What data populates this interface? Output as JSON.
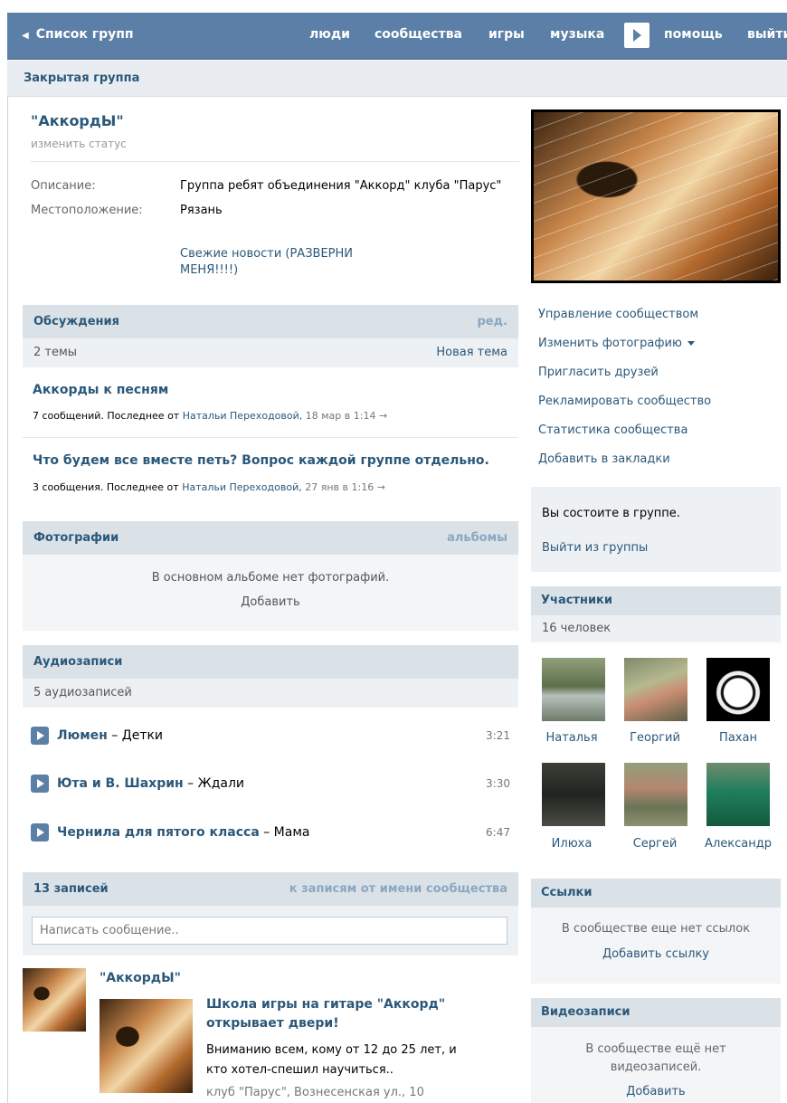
{
  "topbar": {
    "back_label": "Список групп",
    "nav": [
      "люди",
      "сообщества",
      "игры",
      "музыка",
      "помощь",
      "выйти"
    ]
  },
  "subheader": {
    "title": "Закрытая группа"
  },
  "group": {
    "name": "\"АккордЫ\"",
    "status_link": "изменить статус",
    "description_label": "Описание:",
    "description_value": "Группа ребят объединения \"Аккорд\" клуба \"Парус\"",
    "location_label": "Местоположение:",
    "location_value": "Рязань",
    "news_link": "Свежие новости (РАЗВЕРНИ МЕНЯ!!!!)"
  },
  "discussions": {
    "title": "Обсуждения",
    "edit": "ред.",
    "count": "2 темы",
    "new_topic": "Новая тема",
    "topics": [
      {
        "title": "Аккорды к песням",
        "meta_prefix": "7 сообщений. Последнее от",
        "author": "Натальи Переходовой,",
        "date": "18 мар в 1:14",
        "arrow": "→"
      },
      {
        "title": "Что будем все вместе петь? Вопрос каждой группе отдельно.",
        "meta_prefix": "3 сообщения. Последнее от",
        "author": "Натальи Переходовой,",
        "date": "27 янв в 1:16",
        "arrow": "→"
      }
    ]
  },
  "photos": {
    "title": "Фотографии",
    "albums": "альбомы",
    "empty": "В основном альбоме нет фотографий.",
    "add": "Добавить"
  },
  "audio": {
    "title": "Аудиозаписи",
    "count": "5 аудиозаписей",
    "tracks": [
      {
        "artist": "Люмен",
        "sep": " – ",
        "song": "Детки",
        "time": "3:21"
      },
      {
        "artist": "Юта и В. Шахрин",
        "sep": " – ",
        "song": "Ждали",
        "time": "3:30"
      },
      {
        "artist": "Чернила для пятого класса",
        "sep": " – ",
        "song": "Мама",
        "time": "6:47"
      }
    ]
  },
  "wall": {
    "title": "13 записей",
    "as_community": "к записям от имени сообщества",
    "placeholder": "Написать сообщение..",
    "post": {
      "author": "\"АккордЫ\"",
      "title": "Школа игры на гитаре \"Аккорд\" открывает двери!",
      "text": "Вниманию всем, кому от 12 до 25 лет, и кто хотел-спешил научиться..",
      "address": "клуб \"Парус\", Вознесенская ул., 10"
    }
  },
  "actions": [
    "Управление сообществом",
    "Изменить фотографию",
    "Пригласить друзей",
    "Рекламировать сообщество",
    "Статистика сообщества",
    "Добавить в закладки"
  ],
  "membership": {
    "status": "Вы состоите в группе.",
    "leave": "Выйти из группы"
  },
  "members": {
    "title": "Участники",
    "count": "16 человек",
    "list": [
      "Наталья",
      "Георгий",
      "Пахан",
      "Илюха",
      "Сергей",
      "Александр"
    ]
  },
  "links": {
    "title": "Ссылки",
    "empty": "В сообществе еще нет ссылок",
    "add": "Добавить ссылку"
  },
  "videos": {
    "title": "Видеозаписи",
    "empty": "В сообществе ещё нет видеозаписей.",
    "add": "Добавить"
  }
}
